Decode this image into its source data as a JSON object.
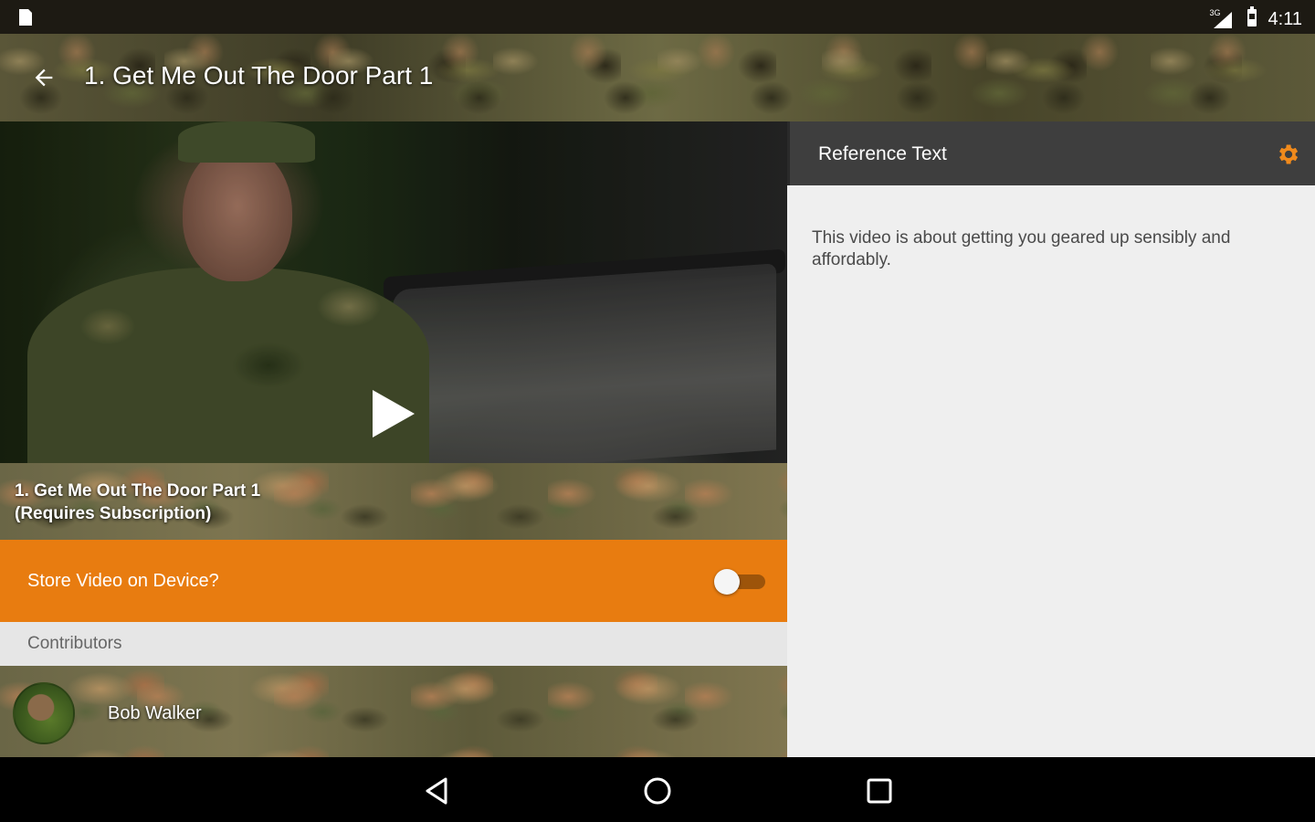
{
  "status_bar": {
    "time": "4:11",
    "network_label": "3G",
    "icons": [
      "sd-card-icon",
      "signal-icon",
      "battery-icon"
    ]
  },
  "app_bar": {
    "title": "1. Get Me Out The Door Part 1",
    "back_icon": "arrow-back-icon"
  },
  "video": {
    "play_icon": "play-icon",
    "caption_line1": "1. Get Me Out The Door Part 1",
    "caption_line2": "(Requires Subscription)"
  },
  "store_option": {
    "label": "Store Video on Device?",
    "enabled": false,
    "accent": "#e87c10"
  },
  "contributors": {
    "header": "Contributors",
    "items": [
      {
        "name": "Bob Walker"
      }
    ]
  },
  "reference": {
    "title": "Reference Text",
    "settings_icon": "gear-icon",
    "settings_color": "#f08a1c",
    "body": "This video is about getting you geared up sensibly and affordably."
  },
  "nav_bar": {
    "icons": [
      "back-triangle-icon",
      "home-circle-icon",
      "recents-square-icon"
    ]
  }
}
